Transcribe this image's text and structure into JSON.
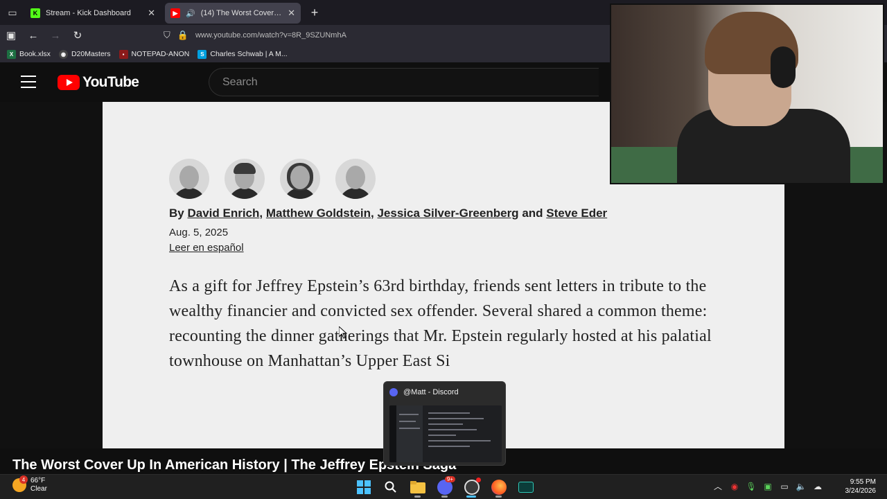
{
  "browser": {
    "tabs": [
      {
        "title": "Stream - Kick Dashboard",
        "active": false,
        "icon": "kick-icon"
      },
      {
        "title": "(14) The Worst Cover Up In",
        "active": true,
        "icon": "youtube-icon"
      }
    ],
    "url": "www.youtube.com/watch?v=8R_9SZUNmhA",
    "bookmarks": [
      "Book.xlsx",
      "D20Masters",
      "NOTEPAD-ANON",
      "Charles Schwab | A M..."
    ]
  },
  "youtube": {
    "logo_text": "YouTube",
    "search_placeholder": "Search"
  },
  "article": {
    "by_prefix": "By",
    "authors": [
      "David Enrich",
      "Matthew Goldstein",
      "Jessica Silver-Greenberg",
      "Steve Eder"
    ],
    "sep_comma": ",",
    "and_word": "and",
    "date": "Aug. 5, 2025",
    "spanish_link": "Leer en español",
    "lede": "As a gift for Jeffrey Epstein’s 63rd birthday, friends sent letters in tribute to the wealthy financier and convicted sex offender. Several shared a common theme: recounting the dinner gatherings that Mr. Epstein regularly hosted at his palatial townhouse on Manhattan’s Upper East Si"
  },
  "video": {
    "title": "The Worst Cover Up In American History | The Jeffrey Epstein Saga"
  },
  "discord_popup": {
    "title": "@Matt - Discord"
  },
  "taskbar": {
    "weather_temp": "66°F",
    "weather_cond": "Clear",
    "weather_badge": "4",
    "discord_badge": "9+",
    "time": "9:55 PM",
    "date": "3/24/2026"
  },
  "colors": {
    "youtube_red": "#ff0000",
    "kick_green": "#53fc18",
    "windows_blue": "#4cc2ff",
    "discord": "#5865f2"
  }
}
